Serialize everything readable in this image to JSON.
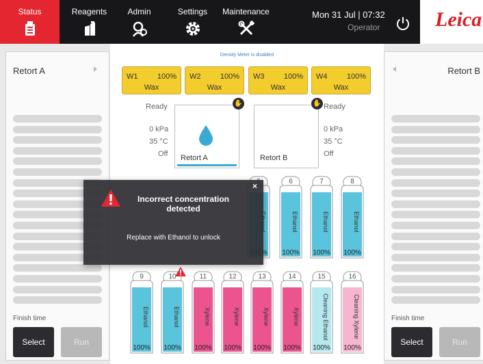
{
  "nav": {
    "tabs": [
      {
        "label": "Status",
        "icon": "status-icon",
        "active": true
      },
      {
        "label": "Reagents",
        "icon": "reagents-icon",
        "active": false
      },
      {
        "label": "Admin",
        "icon": "admin-icon",
        "active": false
      },
      {
        "label": "Settings",
        "icon": "gear-icon",
        "active": false
      },
      {
        "label": "Maintenance",
        "icon": "tools-icon",
        "active": false
      }
    ],
    "clock": "Mon 31 Jul | 07:32",
    "user": "Operator",
    "logo": "Leica"
  },
  "colors": {
    "accent": "#e3262f",
    "wax": "#f3cc2d",
    "ethanol": "#5ac4dc",
    "xylene": "#ec5490",
    "cleaning_ethanol": "#b5e8ef",
    "cleaning_xylene": "#f6b6cf"
  },
  "left_panel": {
    "title": "Retort A",
    "finish_label": "Finish time",
    "select_label": "Select",
    "run_label": "Run"
  },
  "right_panel": {
    "title": "Retort B",
    "finish_label": "Finish time",
    "select_label": "Select",
    "run_label": "Run"
  },
  "density_note": "Density Meter is disabled",
  "wax_stations": [
    {
      "id": "W1",
      "percent": "100%",
      "reagent": "Wax"
    },
    {
      "id": "W2",
      "percent": "100%",
      "reagent": "Wax"
    },
    {
      "id": "W3",
      "percent": "100%",
      "reagent": "Wax"
    },
    {
      "id": "W4",
      "percent": "100%",
      "reagent": "Wax"
    }
  ],
  "retort_a": {
    "name": "Retort A",
    "state": "Ready",
    "pressure": "0 kPa",
    "temperature": "35 °C",
    "stirrer": "Off"
  },
  "retort_b": {
    "name": "Retort B",
    "state": "Ready",
    "pressure": "0 kPa",
    "temperature": "35 °C",
    "stirrer": "Off"
  },
  "bottles_top": [
    {
      "num": "5",
      "reagent": "Ethanol",
      "percent": "100%",
      "kind": "ethanol"
    },
    {
      "num": "6",
      "reagent": "Ethanol",
      "percent": "100%",
      "kind": "ethanol"
    },
    {
      "num": "7",
      "reagent": "Ethanol",
      "percent": "100%",
      "kind": "ethanol"
    },
    {
      "num": "8",
      "reagent": "Ethanol",
      "percent": "100%",
      "kind": "ethanol"
    }
  ],
  "bottles_bottom": [
    {
      "num": "9",
      "reagent": "Ethanol",
      "percent": "100%",
      "kind": "ethanol"
    },
    {
      "num": "10",
      "reagent": "Ethanol",
      "percent": "100%",
      "kind": "ethanol"
    },
    {
      "num": "11",
      "reagent": "Xylene",
      "percent": "100%",
      "kind": "xylene"
    },
    {
      "num": "12",
      "reagent": "Xylene",
      "percent": "100%",
      "kind": "xylene"
    },
    {
      "num": "13",
      "reagent": "Xylene",
      "percent": "100%",
      "kind": "xylene"
    },
    {
      "num": "14",
      "reagent": "Xylene",
      "percent": "100%",
      "kind": "xylene"
    },
    {
      "num": "15",
      "reagent": "Cleaning Ethanol",
      "percent": "100%",
      "kind": "cleaning_ethanol"
    },
    {
      "num": "16",
      "reagent": "Cleaning Xylene",
      "percent": "100%",
      "kind": "cleaning_xylene"
    }
  ],
  "alert": {
    "title": "Incorrect concentration detected",
    "message": "Replace with Ethanol to unlock",
    "close": "×"
  }
}
